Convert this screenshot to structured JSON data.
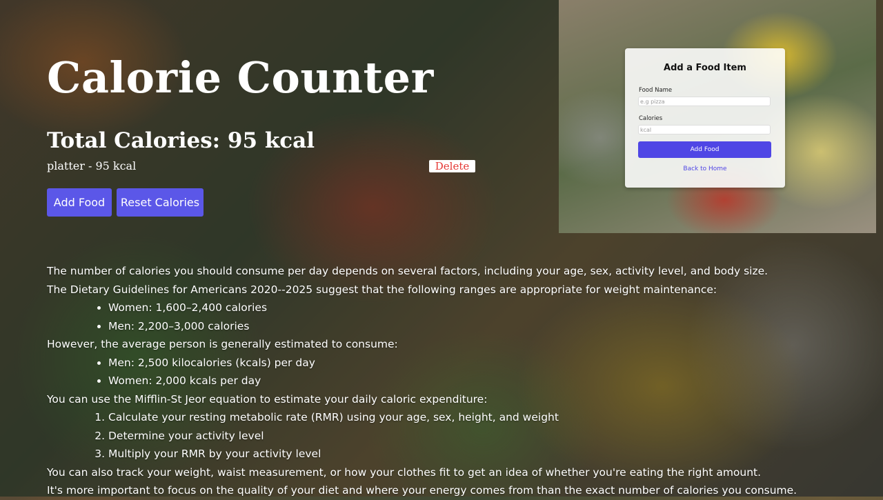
{
  "header": {
    "title": "Calorie Counter",
    "total": "Total Calories: 95 kcal"
  },
  "entries": [
    {
      "text": "platter - 95 kcal",
      "delete_label": "Delete"
    }
  ],
  "actions": {
    "add_label": "Add Food",
    "reset_label": "Reset Calories"
  },
  "form": {
    "title": "Add a Food Item",
    "name_label": "Food Name",
    "name_placeholder": "e.g pizza",
    "calories_label": "Calories",
    "calories_placeholder": "kcal",
    "submit_label": "Add Food",
    "back_link": "Back to Home"
  },
  "info": {
    "p1": "The number of calories you should consume per day depends on several factors, including your age, sex, activity level, and body size.",
    "p2": "The Dietary Guidelines for Americans 2020--2025 suggest that the following ranges are appropriate for weight maintenance:",
    "list1": [
      "Women: 1,600–2,400 calories",
      "Men: 2,200–3,000 calories"
    ],
    "p3": "However, the average person is generally estimated to consume:",
    "list2": [
      "Men: 2,500 kilocalories (kcals) per day",
      "Women: 2,000 kcals per day"
    ],
    "p4": "You can use the Mifflin-St Jeor equation to estimate your daily caloric expenditure:",
    "steps": [
      "Calculate your resting metabolic rate (RMR) using your age, sex, height, and weight",
      "Determine your activity level",
      "Multiply your RMR by your activity level"
    ],
    "p5": "You can also track your weight, waist measurement, or how your clothes fit to get an idea of whether you're eating the right amount.",
    "p6": "It's more important to focus on the quality of your diet and where your energy comes from than the exact number of calories you consume."
  }
}
